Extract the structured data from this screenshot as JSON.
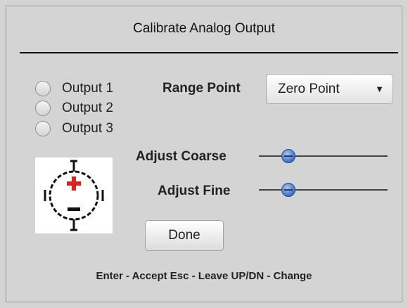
{
  "dialog": {
    "title": "Calibrate Analog Output"
  },
  "outputs": [
    {
      "label": "Output 1",
      "selected": false
    },
    {
      "label": "Output 2",
      "selected": false
    },
    {
      "label": "Output 3",
      "selected": false
    }
  ],
  "range_point": {
    "label": "Range Point",
    "selected_value": "Zero Point"
  },
  "adjust_coarse": {
    "label": "Adjust Coarse",
    "level": 0.23
  },
  "adjust_fine": {
    "label": "Adjust Fine",
    "level": 0.23
  },
  "icon": {
    "name": "output-terminal-icon",
    "plus_color": "#e0201a",
    "minus_color": "#111111"
  },
  "done_button": {
    "label": "Done"
  },
  "hint": "Enter - Accept Esc - Leave UP/DN - Change"
}
